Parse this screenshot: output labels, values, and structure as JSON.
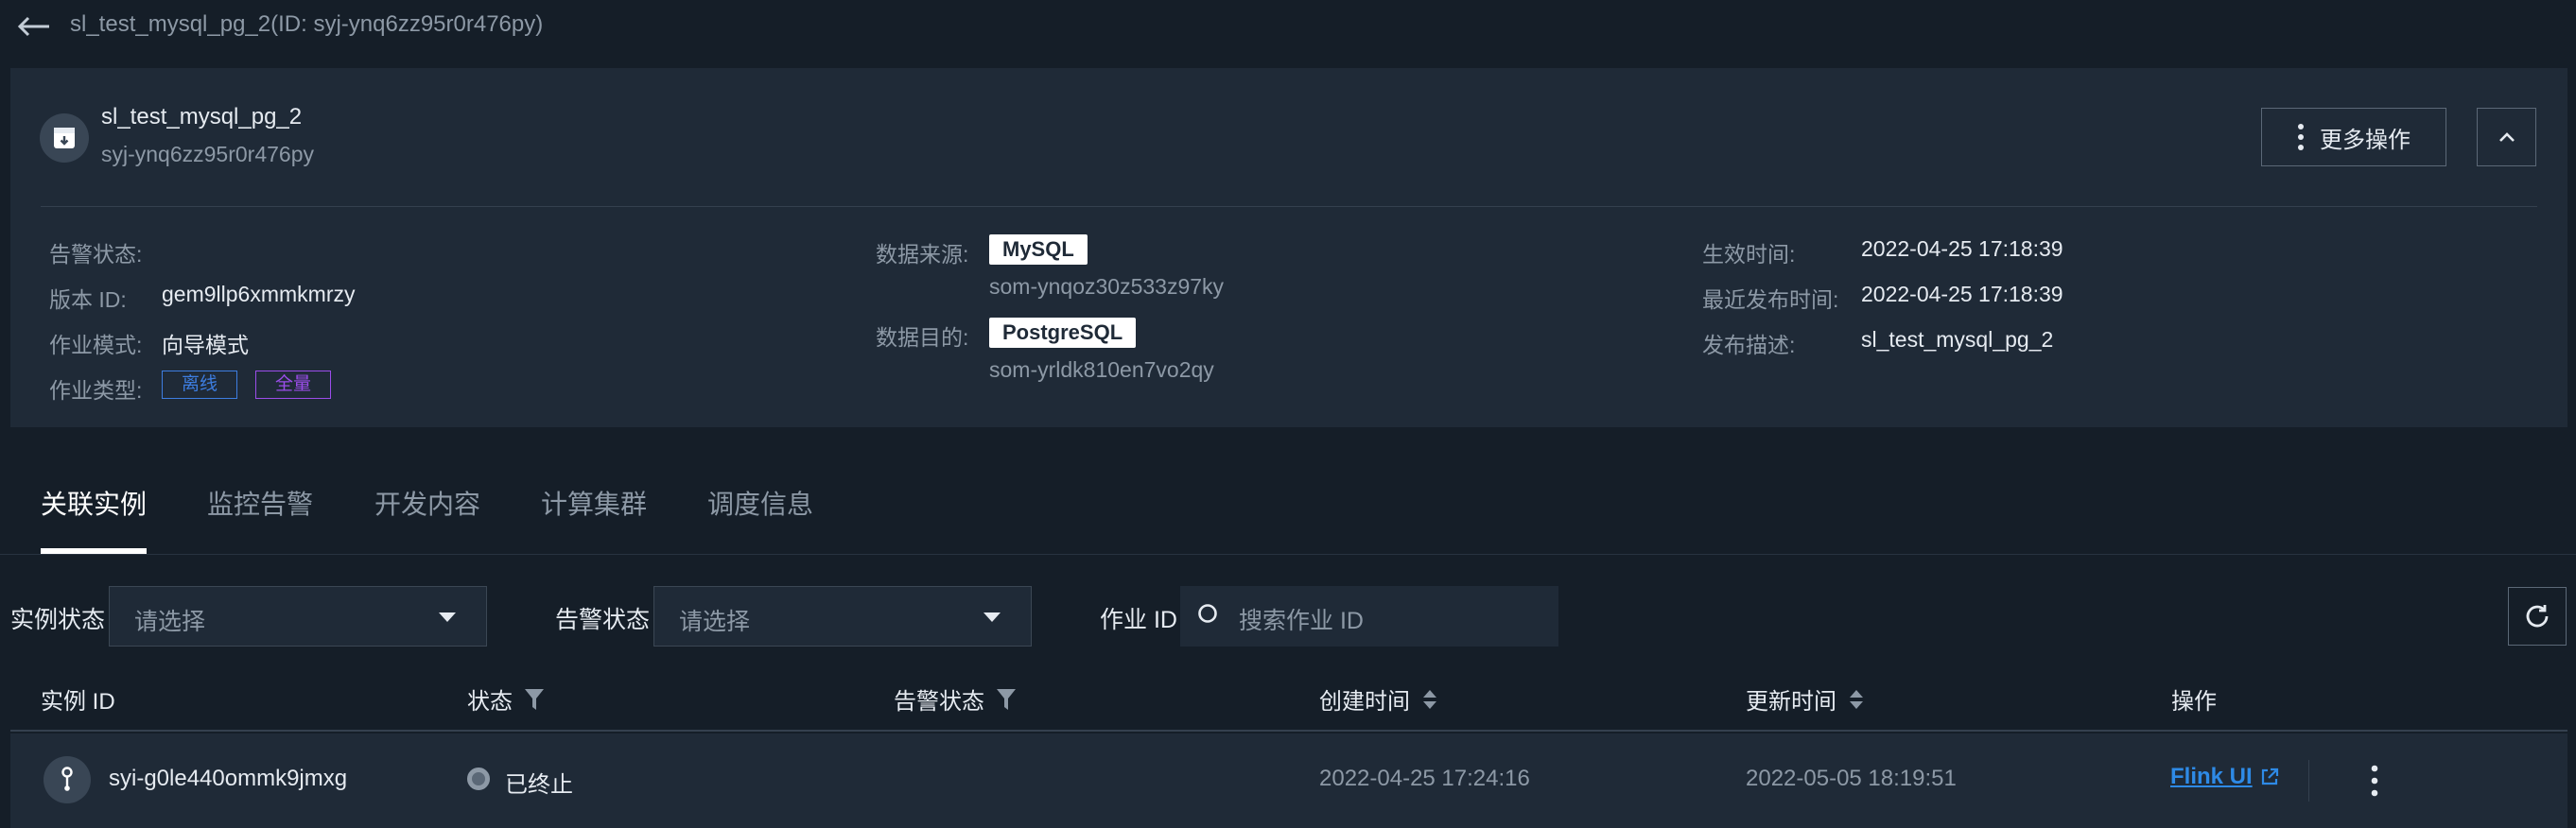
{
  "header": {
    "title": "sl_test_mysql_pg_2(ID: syj-ynq6zz95r0r476py)"
  },
  "job": {
    "name": "sl_test_mysql_pg_2",
    "id": "syj-ynq6zz95r0r476py",
    "more_actions_label": "更多操作"
  },
  "info": {
    "alarm_status_label": "告警状态:",
    "version_id_label": "版本 ID:",
    "version_id_value": "gem9llp6xmmkmrzy",
    "job_mode_label": "作业模式:",
    "job_mode_value": "向导模式",
    "job_type_label": "作业类型:",
    "job_type_tags": [
      "离线",
      "全量"
    ],
    "source_label": "数据来源:",
    "source_type": "MySQL",
    "source_id": "som-ynqoz30z533z97ky",
    "target_label": "数据目的:",
    "target_type": "PostgreSQL",
    "target_id": "som-yrldk810en7vo2qy",
    "effective_time_label": "生效时间:",
    "effective_time_value": "2022-04-25 17:18:39",
    "last_publish_label": "最近发布时间:",
    "last_publish_value": "2022-04-25 17:18:39",
    "publish_desc_label": "发布描述:",
    "publish_desc_value": "sl_test_mysql_pg_2"
  },
  "tabs": [
    "关联实例",
    "监控告警",
    "开发内容",
    "计算集群",
    "调度信息"
  ],
  "filters": {
    "instance_status_label": "实例状态",
    "instance_status_placeholder": "请选择",
    "alarm_status_label": "告警状态",
    "alarm_status_placeholder": "请选择",
    "job_id_label": "作业 ID",
    "job_id_placeholder": "搜索作业 ID"
  },
  "table": {
    "columns": [
      "实例 ID",
      "状态",
      "告警状态",
      "创建时间",
      "更新时间",
      "操作"
    ],
    "rows": [
      {
        "instance_id": "syi-g0le440ommk9jmxg",
        "status": "已终止",
        "alarm_status": "",
        "created": "2022-04-25 17:24:16",
        "updated": "2022-05-05 18:19:51",
        "action_link": "Flink UI"
      }
    ]
  },
  "icons": {
    "back": "arrow-left-icon",
    "job": "archive-icon",
    "more": "more-vertical-icon",
    "collapse": "chevron-up-icon",
    "search": "search-icon",
    "refresh": "refresh-icon",
    "filter": "filter-icon",
    "sort": "sort-icon",
    "instance": "instance-icon",
    "external": "external-link-icon"
  },
  "colors": {
    "background": "#151e28",
    "panel": "#1f2a37",
    "link": "#2e8ae6",
    "tag_blue": "#3d7de0",
    "tag_purple": "#9b4dea"
  }
}
